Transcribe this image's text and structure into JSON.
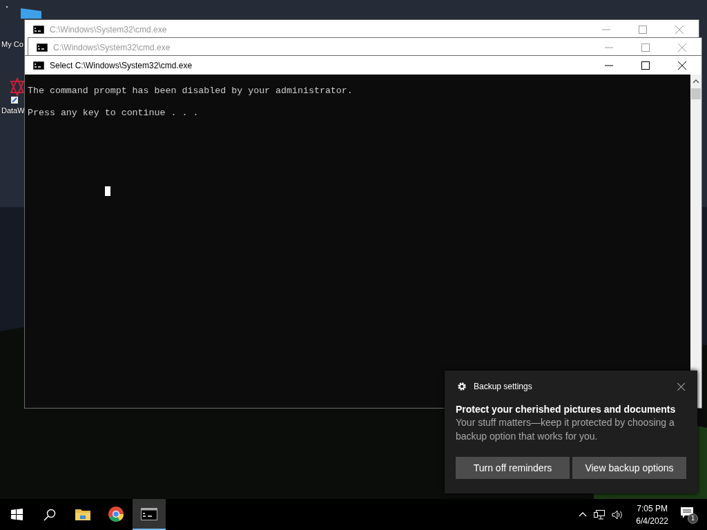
{
  "desktop_icons": [
    {
      "kind": "computer",
      "label": "My Co"
    },
    {
      "kind": "app",
      "label": "DataW"
    }
  ],
  "windows": [
    {
      "title": "C:\\Windows\\System32\\cmd.exe",
      "active": false
    },
    {
      "title": "C:\\Windows\\System32\\cmd.exe",
      "active": false
    },
    {
      "title": "Select C:\\Windows\\System32\\cmd.exe",
      "active": true,
      "console_lines": [
        "The command prompt has been disabled by your administrator.",
        "Press any key to continue . . ."
      ]
    }
  ],
  "toast": {
    "app": "Backup settings",
    "heading": "Protect your cherished pictures and documents",
    "body": "Your stuff matters—keep it protected by choosing a backup option that works for you.",
    "buttons": [
      "Turn off reminders",
      "View backup options"
    ]
  },
  "taskbar": {
    "apps": [
      {
        "kind": "folder",
        "selected": false
      },
      {
        "kind": "chrome",
        "selected": false
      },
      {
        "kind": "terminal",
        "selected": true
      }
    ],
    "time": "7:05 PM",
    "date": "6/4/2022",
    "notification_count": "1"
  }
}
